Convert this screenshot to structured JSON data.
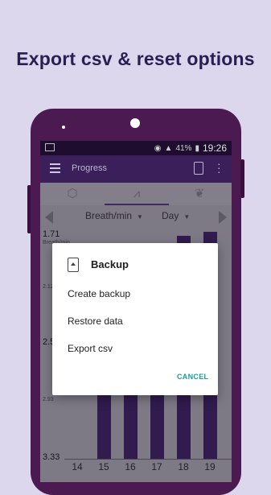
{
  "promo": {
    "title": "Export csv & reset options"
  },
  "statusbar": {
    "battery": "41%",
    "time": "19:26"
  },
  "appbar": {
    "title": "Progress"
  },
  "filters": {
    "metric": "Breath/min",
    "period": "Day"
  },
  "chart_data": {
    "type": "bar",
    "categories": [
      "14",
      "15",
      "16",
      "17",
      "18",
      "19"
    ],
    "y_tick_labels": [
      "1.71",
      "2.12",
      "2.5",
      "2.93",
      "3.33"
    ],
    "y_label_small": "Breath/min",
    "values": [
      3.33,
      2.45,
      2.45,
      2.45,
      1.73,
      1.7
    ],
    "ylim": [
      1.71,
      3.33
    ],
    "y_inverted": true,
    "bar_color": "#311b4f"
  },
  "dialog": {
    "title": "Backup",
    "items": [
      "Create backup",
      "Restore data",
      "Export csv"
    ],
    "cancel_label": "CANCEL",
    "accent": "#1a9a98"
  }
}
